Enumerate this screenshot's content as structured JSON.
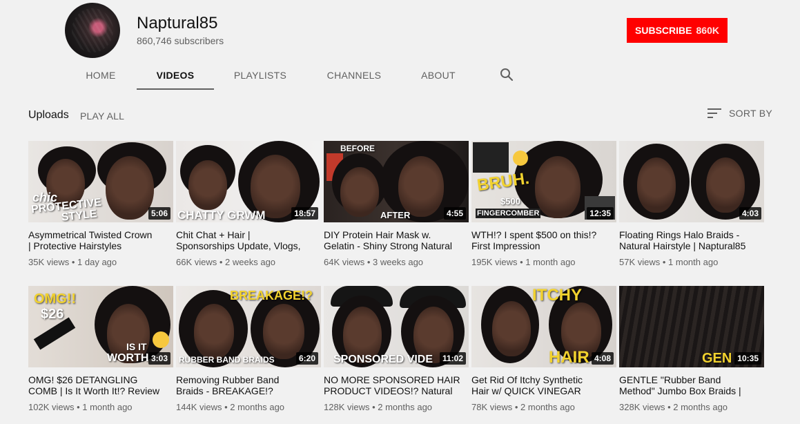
{
  "channel": {
    "name": "Naptural85",
    "subscribers": "860,746 subscribers",
    "subscribe_label": "SUBSCRIBE",
    "subscribe_count": "860K",
    "subscribe_color": "#ff0000"
  },
  "tabs": [
    {
      "label": "HOME",
      "active": false
    },
    {
      "label": "VIDEOS",
      "active": true
    },
    {
      "label": "PLAYLISTS",
      "active": false
    },
    {
      "label": "CHANNELS",
      "active": false
    },
    {
      "label": "ABOUT",
      "active": false
    }
  ],
  "search_icon": "search-icon",
  "uploads": {
    "title": "Uploads",
    "play_all": "PLAY ALL",
    "sort_label": "SORT BY",
    "sort_icon": "sort-icon"
  },
  "videos": [
    {
      "title_line1": "Asymmetrical Twisted Crown",
      "title_line2": "| Protective Hairstyles",
      "views": "35K views",
      "age": "1 day ago",
      "duration": "5:06",
      "thumb_text": [
        "chic",
        "PROTECTIVE",
        "STYLE"
      ]
    },
    {
      "title_line1": "Chit Chat + Hair |",
      "title_line2": "Sponsorships Update, Vlogs,",
      "views": "66K views",
      "age": "2 weeks ago",
      "duration": "18:57",
      "thumb_text": [
        "CHATTY GRWM"
      ]
    },
    {
      "title_line1": "DIY Protein Hair Mask w.",
      "title_line2": "Gelatin - Shiny Strong Natural",
      "views": "64K views",
      "age": "3 weeks ago",
      "duration": "4:55",
      "thumb_text": [
        "BEFORE",
        "AFTER"
      ]
    },
    {
      "title_line1": "WTH!? I spent $500 on this!?",
      "title_line2": "First Impression",
      "views": "195K views",
      "age": "1 month ago",
      "duration": "12:35",
      "thumb_text": [
        "BRUH.",
        "$500",
        "FINGERCOMBER"
      ]
    },
    {
      "title_line1": "Floating Rings Halo Braids -",
      "title_line2": "Natural Hairstyle | Naptural85",
      "views": "57K views",
      "age": "1 month ago",
      "duration": "4:03",
      "thumb_text": []
    },
    {
      "title_line1": "OMG! $26 DETANGLING",
      "title_line2": "COMB | Is It Worth It!? Review",
      "views": "102K views",
      "age": "1 month ago",
      "duration": "3:03",
      "thumb_text": [
        "OMG!!",
        "$26",
        "IS IT",
        "WORTH"
      ]
    },
    {
      "title_line1": "Removing Rubber Band",
      "title_line2": "Braids - BREAKAGE!?",
      "views": "144K views",
      "age": "2 months ago",
      "duration": "6:20",
      "thumb_text": [
        "BREAKAGE!?",
        "RUBBER BAND BRAIDS"
      ]
    },
    {
      "title_line1": "NO MORE SPONSORED HAIR",
      "title_line2": "PRODUCT VIDEOS!? Natural",
      "views": "128K views",
      "age": "2 months ago",
      "duration": "11:02",
      "thumb_text": [
        "SPONSORED VIDE"
      ]
    },
    {
      "title_line1": "Get Rid Of Itchy Synthetic",
      "title_line2": "Hair w/ QUICK VINEGAR",
      "views": "78K views",
      "age": "2 months ago",
      "duration": "4:08",
      "thumb_text": [
        "ITCHY",
        "HAIR"
      ]
    },
    {
      "title_line1": "GENTLE \"Rubber Band",
      "title_line2": "Method\" Jumbo Box Braids |",
      "views": "328K views",
      "age": "2 months ago",
      "duration": "10:35",
      "thumb_text": [
        "GEN"
      ]
    }
  ]
}
